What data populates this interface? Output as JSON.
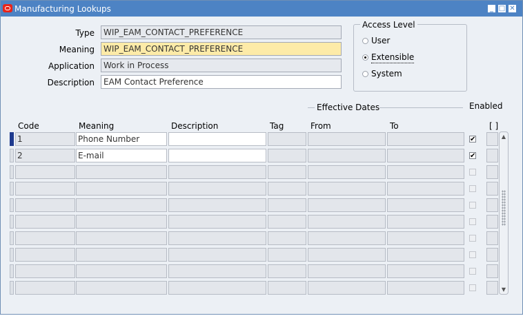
{
  "window": {
    "title": "Manufacturing Lookups"
  },
  "header": {
    "type_label": "Type",
    "type_value": "WIP_EAM_CONTACT_PREFERENCE",
    "meaning_label": "Meaning",
    "meaning_value": "WIP_EAM_CONTACT_PREFERENCE",
    "application_label": "Application",
    "application_value": "Work in Process",
    "description_label": "Description",
    "description_value": "EAM Contact Preference"
  },
  "access_level": {
    "title": "Access Level",
    "options": [
      "User",
      "Extensible",
      "System"
    ],
    "selected": "Extensible"
  },
  "table": {
    "effective_dates_label": "Effective Dates",
    "enabled_label": "Enabled",
    "bracket_label": "[ ]",
    "columns": {
      "code": "Code",
      "meaning": "Meaning",
      "description": "Description",
      "tag": "Tag",
      "from": "From",
      "to": "To"
    },
    "rows": [
      {
        "code": "1",
        "meaning": "Phone Number",
        "description": "",
        "tag": "",
        "from": "",
        "to": "",
        "enabled": true
      },
      {
        "code": "2",
        "meaning": "E-mail",
        "description": "",
        "tag": "",
        "from": "",
        "to": "",
        "enabled": true
      }
    ],
    "empty_rows": 8
  }
}
